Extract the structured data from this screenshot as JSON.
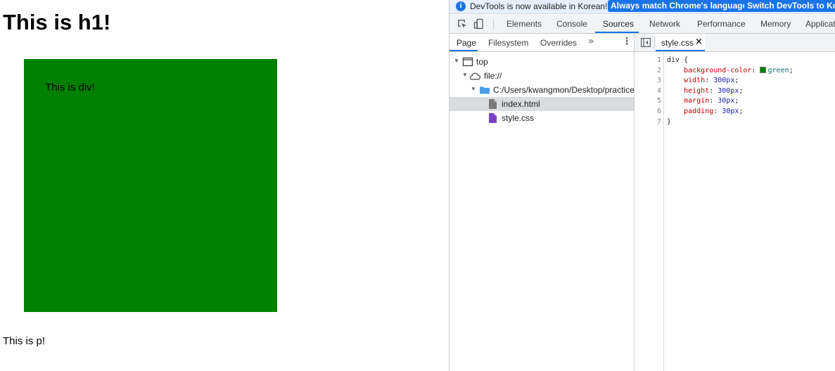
{
  "page": {
    "heading": "This is h1!",
    "div_text": "This is div!",
    "div_color": "#008000",
    "paragraph": "This is p!"
  },
  "infobar": {
    "message": "DevTools is now available in Korean!",
    "button_match": "Always match Chrome's language",
    "button_switch": "Switch DevTools to Korean"
  },
  "toolbar": {
    "tabs": [
      "Elements",
      "Console",
      "Sources",
      "Network",
      "Performance",
      "Memory",
      "Application"
    ],
    "active_tab": "Sources"
  },
  "navigator": {
    "tabs": [
      "Page",
      "Filesystem",
      "Overrides"
    ],
    "active_tab": "Page",
    "tree": [
      {
        "label": "top",
        "icon": "frame-icon"
      },
      {
        "label": "file://",
        "icon": "cloud-icon"
      },
      {
        "label": "C:/Users/kwangmon/Desktop/practice",
        "icon": "folder-icon"
      },
      {
        "label": "index.html",
        "icon": "document-icon",
        "selected": true
      },
      {
        "label": "style.css",
        "icon": "stylesheet-icon"
      }
    ]
  },
  "editor": {
    "tab_label": "style.css",
    "close_glyph": "×",
    "line_numbers": [
      "1",
      "2",
      "3",
      "4",
      "5",
      "6",
      "7"
    ],
    "code": {
      "selector": "div",
      "open_brace": "{",
      "close_brace": "}",
      "decls": [
        {
          "prop": "background-color",
          "value": "green",
          "swatch": "#008000"
        },
        {
          "prop": "width",
          "value": "300px"
        },
        {
          "prop": "height",
          "value": "300px"
        },
        {
          "prop": "margin",
          "value": "30px"
        },
        {
          "prop": "padding",
          "value": "30px"
        }
      ]
    }
  },
  "colors": {
    "accent": "#1a73e8",
    "panel_bg": "#f1f3f4",
    "selected_row": "#dadce0"
  }
}
